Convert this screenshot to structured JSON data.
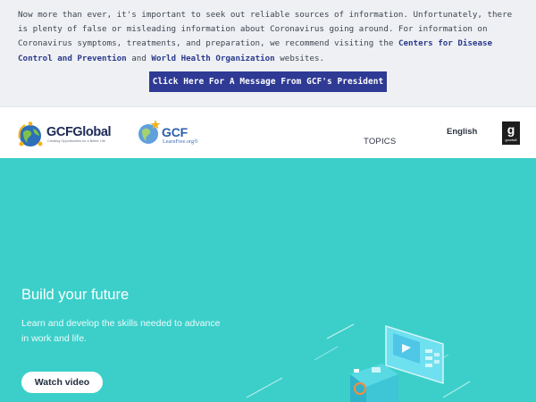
{
  "notice": {
    "text_1": "Now more than ever, it's important to seek out reliable sources of information. Unfortunately, there is plenty of false or misleading information about Coronavirus going around. For information on Coronavirus symptoms, treatments, and preparation, we recommend visiting the",
    "cdc_link": "Centers for Disease Control and Prevention",
    "text_2": "and",
    "who_link": "World Health Organization",
    "text_3": "websites.",
    "button_label": "Click Here For A Message From GCF's President"
  },
  "header": {
    "logo_global_name": "GCFGlobal",
    "logo_global_tagline": "Creating Opportunities for a Better Life",
    "logo_learn_name": "GCF",
    "logo_learn_sub": "LearnFree.org®",
    "topics_label": "TOPICS",
    "language_label": "English",
    "goodwill_letter": "g",
    "goodwill_word": "goodwill"
  },
  "hero": {
    "title": "Build your future",
    "subtitle": "Learn and develop the skills needed to advance in work and life.",
    "button_label": "Watch video"
  },
  "colors": {
    "notice_bg": "#eef0f4",
    "link": "#2b3a8c",
    "button_bg": "#2e3a94",
    "hero_bg": "#3ccfca"
  }
}
